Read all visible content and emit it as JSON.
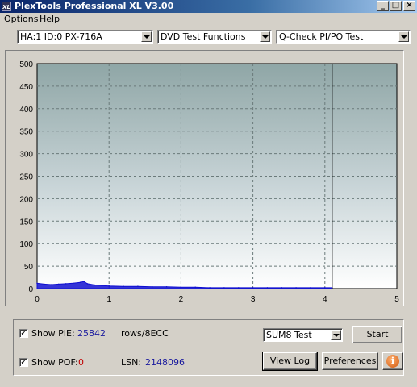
{
  "window": {
    "title": "PlexTools Professional XL V3.00",
    "icon_label": "XL"
  },
  "menu": {
    "items": [
      "Options",
      "Help"
    ]
  },
  "selectors": {
    "drive": "HA:1 ID:0  PX-716A",
    "function": "DVD Test Functions",
    "test": "Q-Check PI/PO Test"
  },
  "chart_data": {
    "type": "area",
    "x_ticks": [
      "0",
      "1",
      "2",
      "3",
      "4",
      "5"
    ],
    "y_ticks": [
      "0",
      "50",
      "100",
      "150",
      "200",
      "250",
      "300",
      "350",
      "400",
      "450",
      "500"
    ],
    "xlim": [
      0,
      5
    ],
    "ylim": [
      0,
      500
    ],
    "grid": true,
    "end_marker_x": 4.1,
    "series": [
      {
        "color": "#1010d0",
        "x": [
          0.0,
          0.1,
          0.2,
          0.3,
          0.4,
          0.5,
          0.6,
          0.65,
          0.7,
          0.8,
          0.9,
          1.0,
          1.2,
          1.4,
          1.6,
          1.8,
          2.0,
          2.2,
          2.4,
          2.6,
          2.8,
          3.0,
          3.2,
          3.4,
          3.6,
          3.8,
          4.0,
          4.1
        ],
        "y": [
          12,
          10,
          9,
          10,
          11,
          12,
          14,
          16,
          11,
          8,
          7,
          6,
          5,
          5,
          4,
          4,
          3,
          3,
          2,
          2,
          2,
          2,
          2,
          2,
          2,
          2,
          2,
          2
        ]
      }
    ]
  },
  "stats": {
    "show_pie_label": "Show PIE:",
    "pie_value": "25842",
    "pie_unit": "rows/8ECC",
    "show_pof_label": "Show POF:",
    "pof_value": "0",
    "lsn_label": "LSN:",
    "lsn_value": "2148096",
    "show_pie_checked": true,
    "show_pof_checked": true
  },
  "controls": {
    "test_mode": "SUM8 Test",
    "start_label": "Start",
    "view_log_label": "View Log",
    "preferences_label": "Preferences",
    "info_glyph": "i"
  }
}
